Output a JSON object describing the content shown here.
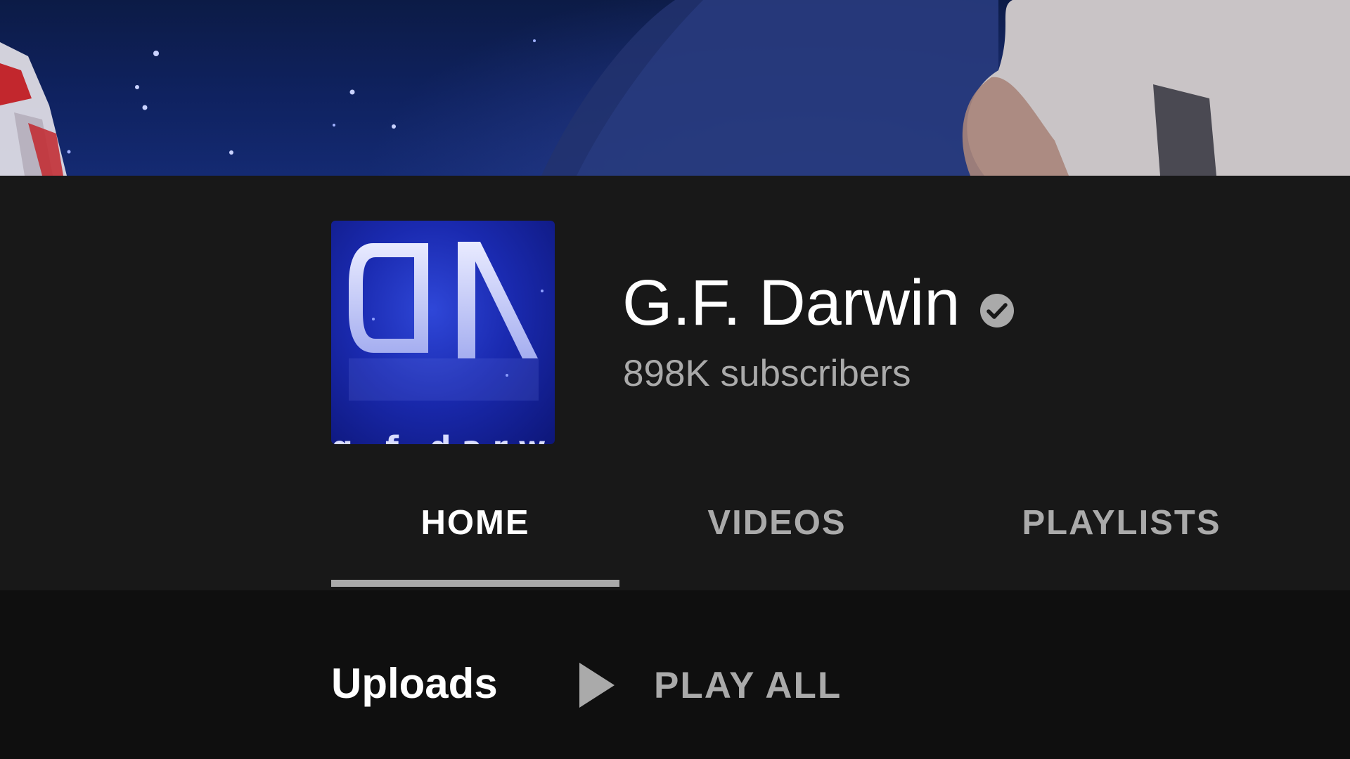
{
  "channel": {
    "name": "G.F. Darwin",
    "verified": true,
    "subscribers": "898K subscribers",
    "avatar_text": "g.f.darwin",
    "avatar_monogram": "DA"
  },
  "tabs": [
    {
      "label": "HOME",
      "selected": true
    },
    {
      "label": "VIDEOS",
      "selected": false
    },
    {
      "label": "PLAYLISTS",
      "selected": false
    }
  ],
  "shelf": {
    "title": "Uploads",
    "play_all_label": "PLAY ALL"
  },
  "icons": {
    "verified": "verified-check-icon",
    "play": "play-icon"
  },
  "colors": {
    "background": "#0f0f0f",
    "header_background": "#181818",
    "text_primary": "#ffffff",
    "text_secondary": "#aaaaaa",
    "avatar_blue": "#1a2ab0"
  }
}
